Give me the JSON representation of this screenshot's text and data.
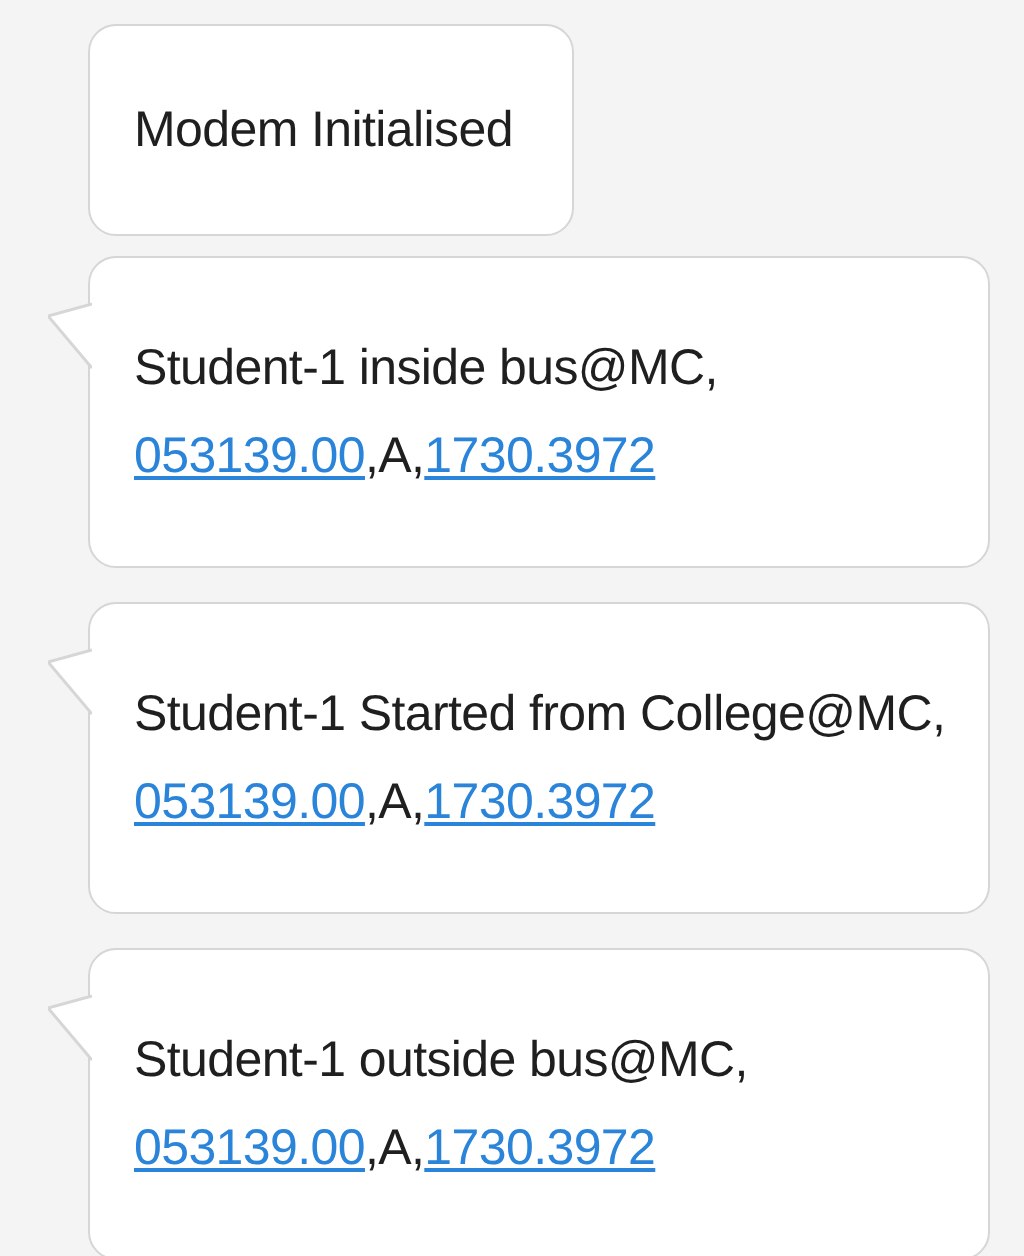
{
  "messages": [
    {
      "tail": false,
      "text": "Modem Initialised"
    },
    {
      "tail": true,
      "text": "Student-1 inside bus@MC,",
      "location": {
        "link_1": "053139.00",
        "separator": ",A,",
        "link_2": "1730.3972"
      }
    },
    {
      "tail": true,
      "text": "Student-1 Started from College@MC,",
      "location": {
        "link_1": "053139.00",
        "separator": ",A,",
        "link_2": "1730.3972"
      }
    },
    {
      "tail": true,
      "text": "Student-1 outside bus@MC,",
      "location": {
        "link_1": "053139.00",
        "separator": ",A,",
        "link_2": "1730.3972"
      }
    }
  ]
}
